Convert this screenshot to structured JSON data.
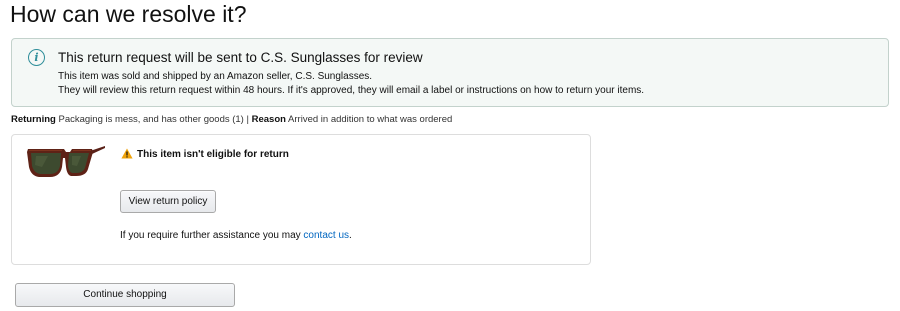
{
  "page": {
    "title": "How can we resolve it?"
  },
  "info_box": {
    "icon": "info-icon",
    "icon_glyph": "i",
    "title": "This return request will be sent to C.S. Sunglasses for review",
    "line1": "This item was sold and shipped by an Amazon seller, C.S. Sunglasses.",
    "line2": "They will review this return request within 48 hours. If it's approved, they will email a label or instructions on how to return your items."
  },
  "return_summary": {
    "returning_label": "Returning",
    "returning_value": " Packaging is mess, and has other goods (1) | ",
    "reason_label": "Reason",
    "reason_value": " Arrived in addition to what was ordered"
  },
  "item": {
    "image": "sunglasses-image",
    "warning_icon": "warning-triangle-icon",
    "warning_text": "This item isn't eligible for return",
    "policy_button": "View return policy",
    "assist_prefix": "If you require further assistance you may ",
    "assist_link": "contact us",
    "assist_suffix": "."
  },
  "footer": {
    "continue_button": "Continue shopping"
  },
  "colors": {
    "info_box_background": "#f4f8f6",
    "info_box_border": "#c3d2cc",
    "info_icon": "#2f8e9a",
    "warning": "#f0a30a",
    "link": "#0066c0"
  }
}
